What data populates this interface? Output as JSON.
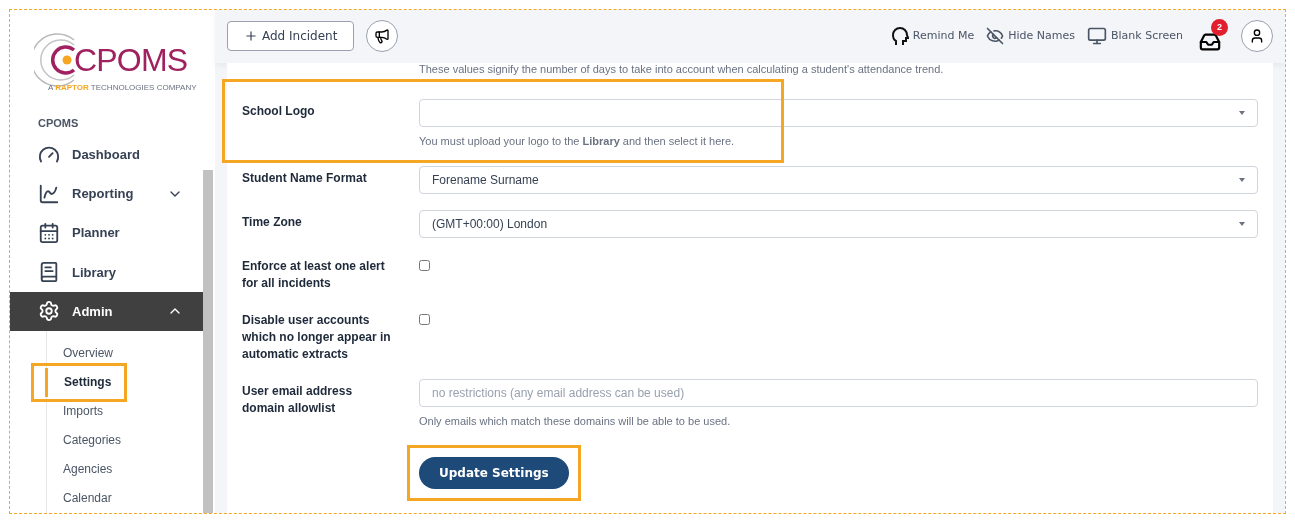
{
  "logo": {
    "name": "CPOMS",
    "tagline_prefix": "A",
    "tagline_brand": "RAPTOR",
    "tagline_suffix": "TECHNOLOGIES COMPANY"
  },
  "sidebar": {
    "heading": "CPOMS",
    "items": [
      {
        "label": "Dashboard",
        "selected": false
      },
      {
        "label": "Reporting",
        "selected": false,
        "expanded": false
      },
      {
        "label": "Planner",
        "selected": false
      },
      {
        "label": "Library",
        "selected": false
      },
      {
        "label": "Admin",
        "selected": true,
        "expanded": true,
        "children": [
          {
            "label": "Overview",
            "selected": false,
            "highlighted": false
          },
          {
            "label": "Settings",
            "selected": true,
            "highlighted": true
          },
          {
            "label": "Imports",
            "selected": false,
            "highlighted": false
          },
          {
            "label": "Categories",
            "selected": false,
            "highlighted": false
          },
          {
            "label": "Agencies",
            "selected": false,
            "highlighted": false
          },
          {
            "label": "Calendar",
            "selected": false,
            "highlighted": false
          }
        ]
      }
    ]
  },
  "topbar": {
    "add_button": "Add Incident",
    "tools": [
      {
        "label": "Remind Me"
      },
      {
        "label": "Hide Names"
      },
      {
        "label": "Blank Screen"
      }
    ],
    "inbox_badge": "2"
  },
  "form": {
    "intro_help": "These values signify the number of days to take into account when calculating a student's attendance trend.",
    "fields": [
      {
        "kind": "select",
        "label": "School Logo",
        "help": "You must upload your logo to the **Library** and then select it here.",
        "highlighted": true
      },
      {
        "kind": "select",
        "label": "Student Name Format",
        "value": "Forename Surname",
        "highlighted": false
      },
      {
        "kind": "select",
        "label": "Time Zone",
        "value": "(GMT+00:00) London",
        "highlighted": false
      },
      {
        "kind": "checkbox",
        "label": "Enforce at least one alert for all incidents",
        "checked": false,
        "highlighted": false
      },
      {
        "kind": "checkbox",
        "label": "Disable user accounts which no longer appear in automatic extracts",
        "checked": false,
        "highlighted": false
      },
      {
        "kind": "text",
        "label": "User email address domain allowlist",
        "placeholder": "no restrictions (any email address can be used)",
        "help": "Only emails which match these domains will be able to be used.",
        "highlighted": false
      }
    ],
    "submit": {
      "label": "Update Settings",
      "highlighted": true
    }
  }
}
